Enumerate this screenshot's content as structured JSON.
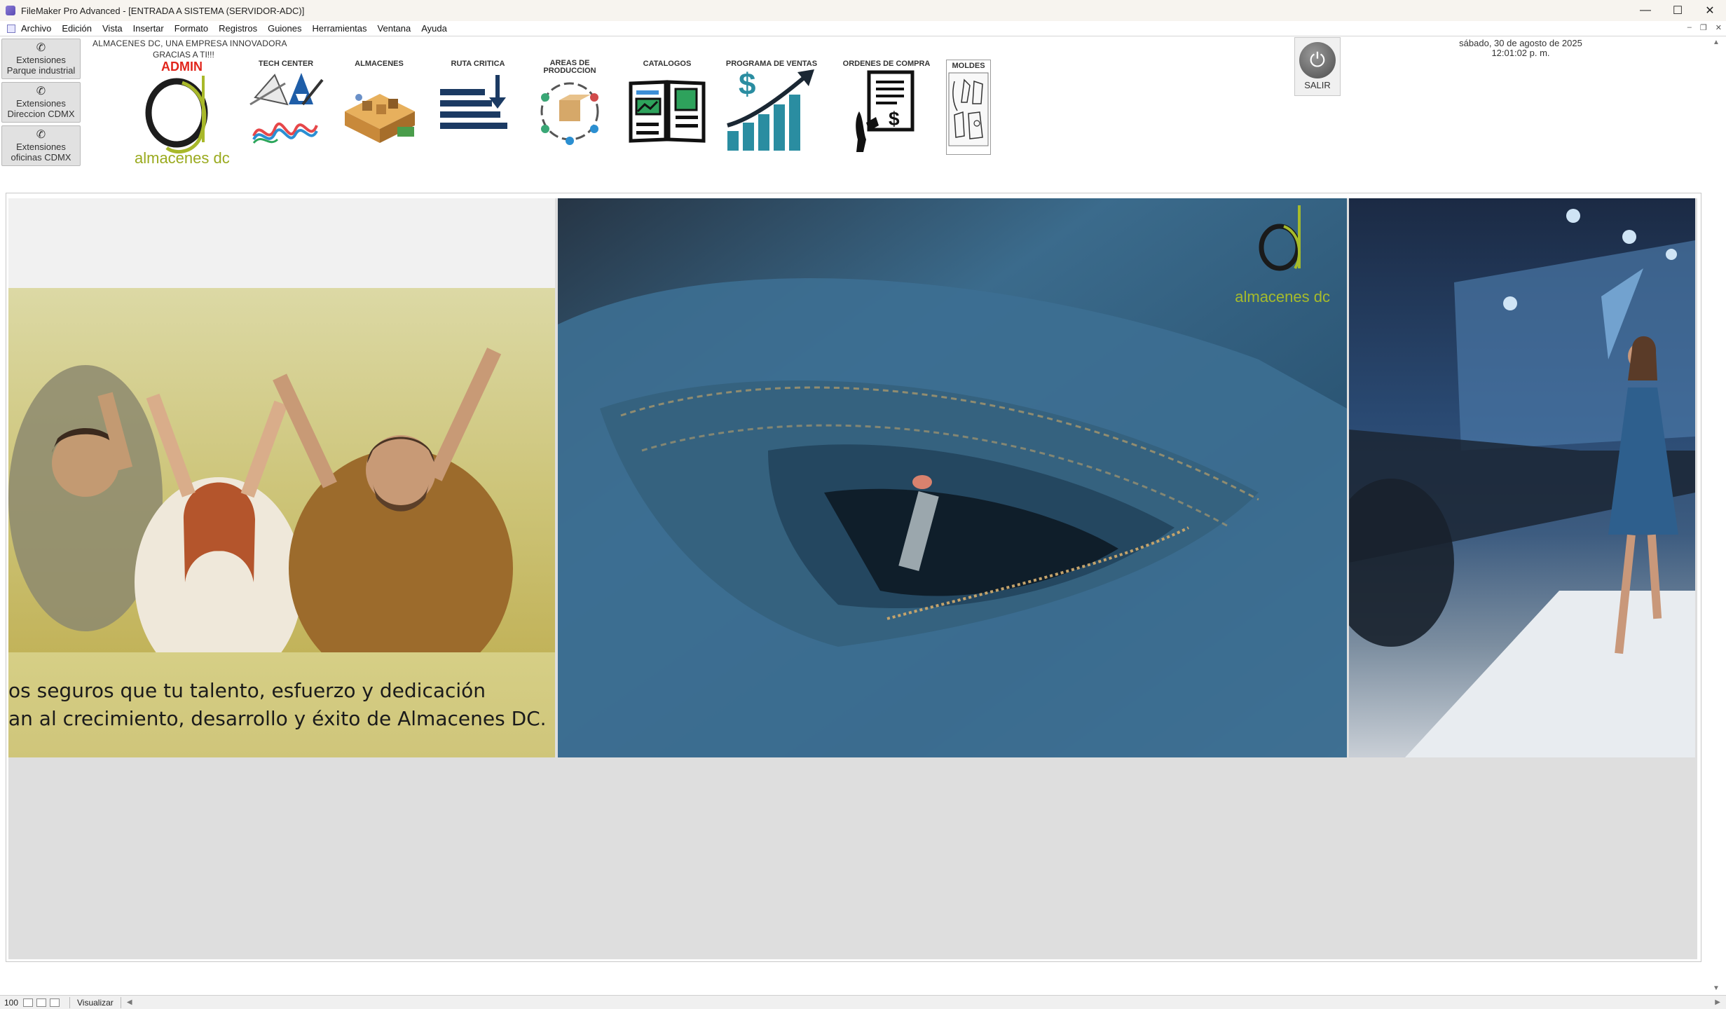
{
  "window": {
    "title": "FileMaker Pro Advanced - [ENTRADA A SISTEMA (SERVIDOR-ADC)]",
    "minimize": "—",
    "maximize": "☐",
    "close": "✕"
  },
  "menu": {
    "items": [
      "Archivo",
      "Edición",
      "Vista",
      "Insertar",
      "Formato",
      "Registros",
      "Guiones",
      "Herramientas",
      "Ventana",
      "Ayuda"
    ]
  },
  "extensions": [
    {
      "line1": "Extensiones",
      "line2": "Parque industrial"
    },
    {
      "line1": "Extensiones",
      "line2": "Direccion CDMX"
    },
    {
      "line1": "Extensiones",
      "line2": "oficinas CDMX"
    }
  ],
  "header": {
    "company": "ALMACENES DC, UNA EMPRESA INNOVADORA",
    "thanks": "GRACIAS A TI!!!",
    "user": "ADMIN",
    "logo_text": "almacenes dc"
  },
  "modules": {
    "tech_center": "TECH CENTER",
    "almacenes": "ALMACENES",
    "ruta_critica": "RUTA CRITICA",
    "areas_produccion": "AREAS DE PRODUCCION",
    "catalogos": "CATALOGOS",
    "programa_ventas": "PROGRAMA DE VENTAS",
    "ordenes_compra": "ORDENES DE COMPRA",
    "moldes": "MOLDES"
  },
  "salir": {
    "label": "SALIR"
  },
  "datetime": {
    "date": "sábado, 30 de agosto de 2025",
    "time": "12:01:02 p. m."
  },
  "banner": {
    "line1": "os seguros que tu talento, esfuerzo y dedicación",
    "line2": "an al crecimiento, desarrollo y éxito de Almacenes DC.",
    "brand": "almacenes dc"
  },
  "statusbar": {
    "zoom": "100",
    "mode": "Visualizar"
  },
  "colors": {
    "admin_red": "#e1251b",
    "brand_green": "#9aaa1e",
    "banner_yellow": "#cfc57a",
    "denim_blue": "#3c6a8c"
  }
}
